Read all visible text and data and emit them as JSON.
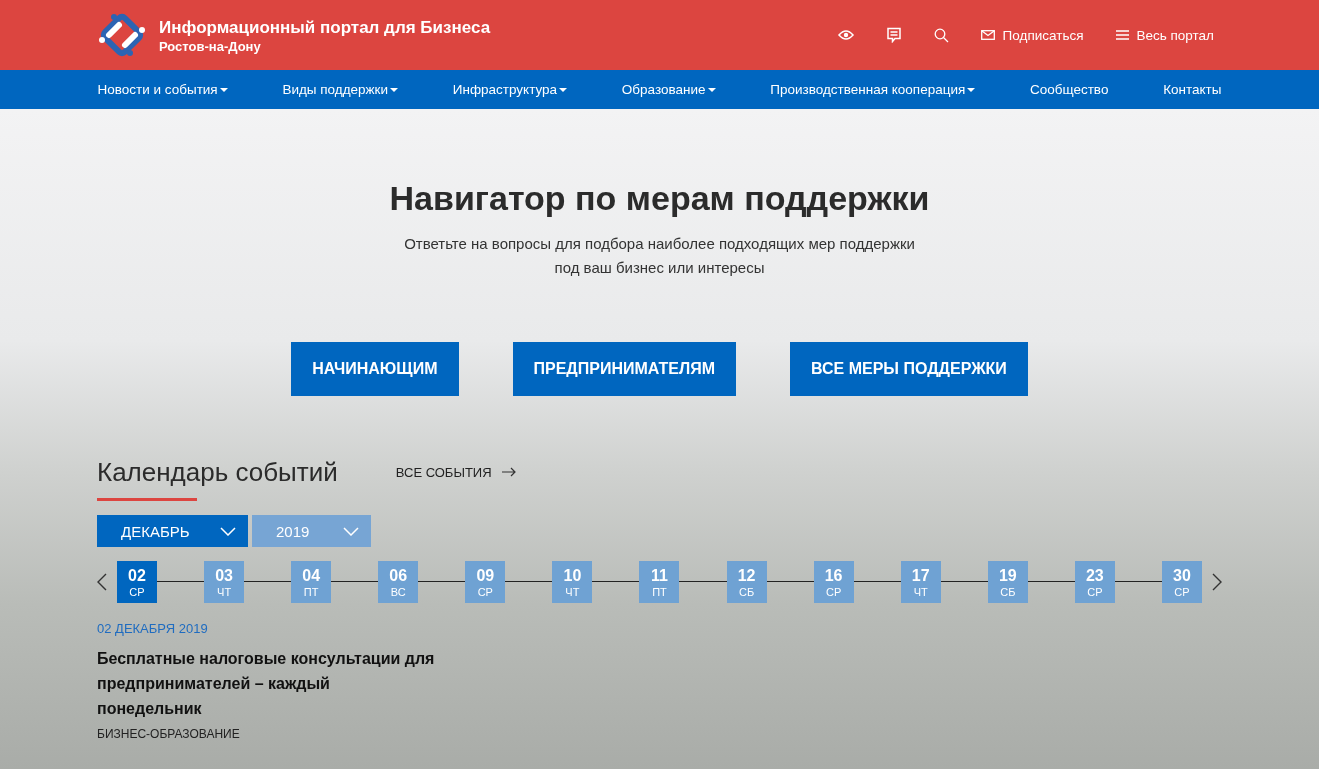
{
  "header": {
    "title": "Информационный портал для Бизнеса",
    "subtitle": "Ростов-на-Дону",
    "actions": [
      {
        "kind": "eye"
      },
      {
        "kind": "chat"
      },
      {
        "kind": "search"
      },
      {
        "kind": "mail",
        "label": "Подписаться"
      },
      {
        "kind": "menu",
        "label": "Весь портал"
      }
    ]
  },
  "nav": [
    {
      "label": "Новости и события",
      "has_menu": true
    },
    {
      "label": "Виды поддержки",
      "has_menu": true
    },
    {
      "label": "Инфраструктура",
      "has_menu": true
    },
    {
      "label": "Образование",
      "has_menu": true
    },
    {
      "label": "Производственная кооперация",
      "has_menu": true
    },
    {
      "label": "Сообщество",
      "has_menu": false
    },
    {
      "label": "Контакты",
      "has_menu": false
    }
  ],
  "hero": {
    "title": "Навигатор по мерам поддержки",
    "subtitle": "Ответьте на вопросы для подбора наиболее подходящих мер поддержки под ваш бизнес или интересы",
    "buttons": [
      "НАЧИНАЮЩИМ",
      "ПРЕДПРИНИМАТЕЛЯМ",
      "ВСЕ МЕРЫ ПОДДЕРЖКИ"
    ]
  },
  "calendar": {
    "title": "Календарь событий",
    "all_link": "ВСЕ СОБЫТИЯ",
    "month": "ДЕКАБРЬ",
    "year": "2019",
    "dates": [
      {
        "day": "02",
        "weekday": "СР",
        "selected": true
      },
      {
        "day": "03",
        "weekday": "ЧТ",
        "selected": false
      },
      {
        "day": "04",
        "weekday": "ПТ",
        "selected": false
      },
      {
        "day": "06",
        "weekday": "ВС",
        "selected": false
      },
      {
        "day": "09",
        "weekday": "СР",
        "selected": false
      },
      {
        "day": "10",
        "weekday": "ЧТ",
        "selected": false
      },
      {
        "day": "11",
        "weekday": "ПТ",
        "selected": false
      },
      {
        "day": "12",
        "weekday": "СБ",
        "selected": false
      },
      {
        "day": "16",
        "weekday": "СР",
        "selected": false
      },
      {
        "day": "17",
        "weekday": "ЧТ",
        "selected": false
      },
      {
        "day": "19",
        "weekday": "СБ",
        "selected": false
      },
      {
        "day": "23",
        "weekday": "СР",
        "selected": false
      },
      {
        "day": "30",
        "weekday": "СР",
        "selected": false
      }
    ],
    "event": {
      "date": "02 ДЕКАБРЯ 2019",
      "title": "Бесплатные налоговые консультации для предпринимателей – каждый понедельник",
      "category": "БИЗНЕС-ОБРАЗОВАНИЕ"
    }
  }
}
